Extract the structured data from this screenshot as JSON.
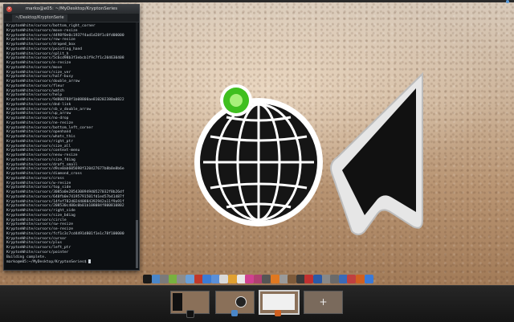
{
  "terminal": {
    "window_title": "marko@e05: ~/MyDesktop/KryptonSeries",
    "tab_label": "~/Desktop/KryptonSerie",
    "lines": [
      "KryptonWhite/cursors/bottom_right_corner",
      "KryptonWhite/cursors/move-resize",
      "KryptonWhite/cursors/4498f0e0c1937f4ad1d28f1c0fd00000",
      "KryptonWhite/cursors/row-resize",
      "KryptonWhite/cursors/draped_box",
      "KryptonWhite/cursors/pointing_hand",
      "KryptonWhite/cursors/split_h",
      "KryptonWhite/cursors/5c6cd98b3f3ebcb1f9c7f1c204630408",
      "KryptonWhite/cursors/e-resize",
      "KryptonWhite/cursors/move",
      "KryptonWhite/cursors/size_ver",
      "KryptonWhite/cursors/half-busy",
      "KryptonWhite/cursors/double_arrow",
      "KryptonWhite/cursors/fleur",
      "KryptonWhite/cursors/watch",
      "KryptonWhite/cursors/help",
      "KryptonWhite/cursors/9d800788f1b08800ae810202380a0822",
      "KryptonWhite/cursors/dnd-link",
      "KryptonWhite/cursors/sb_v_double_arrow",
      "KryptonWhite/cursors/up_arrow",
      "KryptonWhite/cursors/no-drop",
      "KryptonWhite/cursors/ne-resize",
      "KryptonWhite/cursors/bottom_left_corner",
      "KryptonWhite/cursors/openhand",
      "KryptonWhite/cursors/whats_this",
      "KryptonWhite/cursors/right_ptr",
      "KryptonWhite/cursors/size_all",
      "KryptonWhite/cursors/context-menu",
      "KryptonWhite/cursors/nesw-resize",
      "KryptonWhite/cursors/size_fdiag",
      "KryptonWhite/cursors/draft_small",
      "KryptonWhite/cursors/d9ce0ab605698f320427677b8b8e8b6e",
      "KryptonWhite/cursors/diamond_cross",
      "KryptonWhite/cursors/cross",
      "KryptonWhite/cursors/w-resize",
      "KryptonWhite/cursors/top_side",
      "KryptonWhite/cursors/3085a0e285430894940527032f8b26df",
      "KryptonWhite/cursors/640fb0e74195791501fd1ed57b41487f",
      "KryptonWhite/cursors/14fef782d02440884392942a11f9a91f",
      "KryptonWhite/cursors/208530c400c0b01b108084f800810802",
      "KryptonWhite/cursors/right_side",
      "KryptonWhite/cursors/size_bdiag",
      "KryptonWhite/cursors/circle",
      "KryptonWhite/cursors/sw-resize",
      "KryptonWhite/cursors/se-resize",
      "KryptonWhite/cursors/fcf1c3c7cd4491d801f1e1c78f100000",
      "KryptonWhite/cursors/cursor",
      "KryptonWhite/cursors/plus",
      "KryptonWhite/cursors/left_ptr",
      "KryptonWhite/cursors/pointer",
      "Building complete.",
      "marko@e05:~/MyDesktop/KryptonSeries$ "
    ]
  },
  "colors": {
    "globe_dot": "#3fbf1f",
    "terminal_bg": "#0c0f12",
    "panel_bg": "#1c1c1c"
  },
  "dock": {
    "icons": [
      {
        "name": "terminal-icon",
        "color": "#1a1a1a"
      },
      {
        "name": "chromium-icon",
        "color": "#4a86c8"
      },
      {
        "name": "settings-icon",
        "color": "#7a7a7a"
      },
      {
        "name": "android-icon",
        "color": "#78b13f"
      },
      {
        "name": "gear-icon",
        "color": "#8c8c8c"
      },
      {
        "name": "folder-icon",
        "color": "#6aa0d8"
      },
      {
        "name": "app-icon",
        "color": "#c0392b"
      },
      {
        "name": "maps-icon",
        "color": "#3a7bd5"
      },
      {
        "name": "bluetooth-icon",
        "color": "#5a8fd8"
      },
      {
        "name": "calendar-icon",
        "color": "#d9d9d9"
      },
      {
        "name": "photos-icon",
        "color": "#e0a030"
      },
      {
        "name": "document-icon",
        "color": "#e8e8e8"
      },
      {
        "name": "paint-icon",
        "color": "#d04090"
      },
      {
        "name": "gallery-icon",
        "color": "#b04070"
      },
      {
        "name": "image-icon",
        "color": "#555"
      },
      {
        "name": "vlc-icon",
        "color": "#e07820"
      },
      {
        "name": "app2-icon",
        "color": "#9a9a9a"
      },
      {
        "name": "archive-icon",
        "color": "#7d5a3a"
      },
      {
        "name": "calculator-icon",
        "color": "#3a3a3a"
      },
      {
        "name": "music-icon",
        "color": "#c03030"
      },
      {
        "name": "eye-icon",
        "color": "#2a5aa8"
      },
      {
        "name": "system-icon",
        "color": "#888"
      },
      {
        "name": "app3-icon",
        "color": "#6a6a6a"
      },
      {
        "name": "font-icon",
        "color": "#3a6ab8"
      },
      {
        "name": "mail-icon",
        "color": "#c04040"
      },
      {
        "name": "firefox-icon",
        "color": "#d06020"
      },
      {
        "name": "globe-icon",
        "color": "#3a7ad8"
      }
    ]
  },
  "workspaces": [
    {
      "name": "workspace-1",
      "type": "terminal"
    },
    {
      "name": "workspace-2",
      "type": "cursor"
    },
    {
      "name": "workspace-3",
      "type": "white"
    },
    {
      "name": "add-workspace",
      "type": "add",
      "label": "+"
    }
  ]
}
